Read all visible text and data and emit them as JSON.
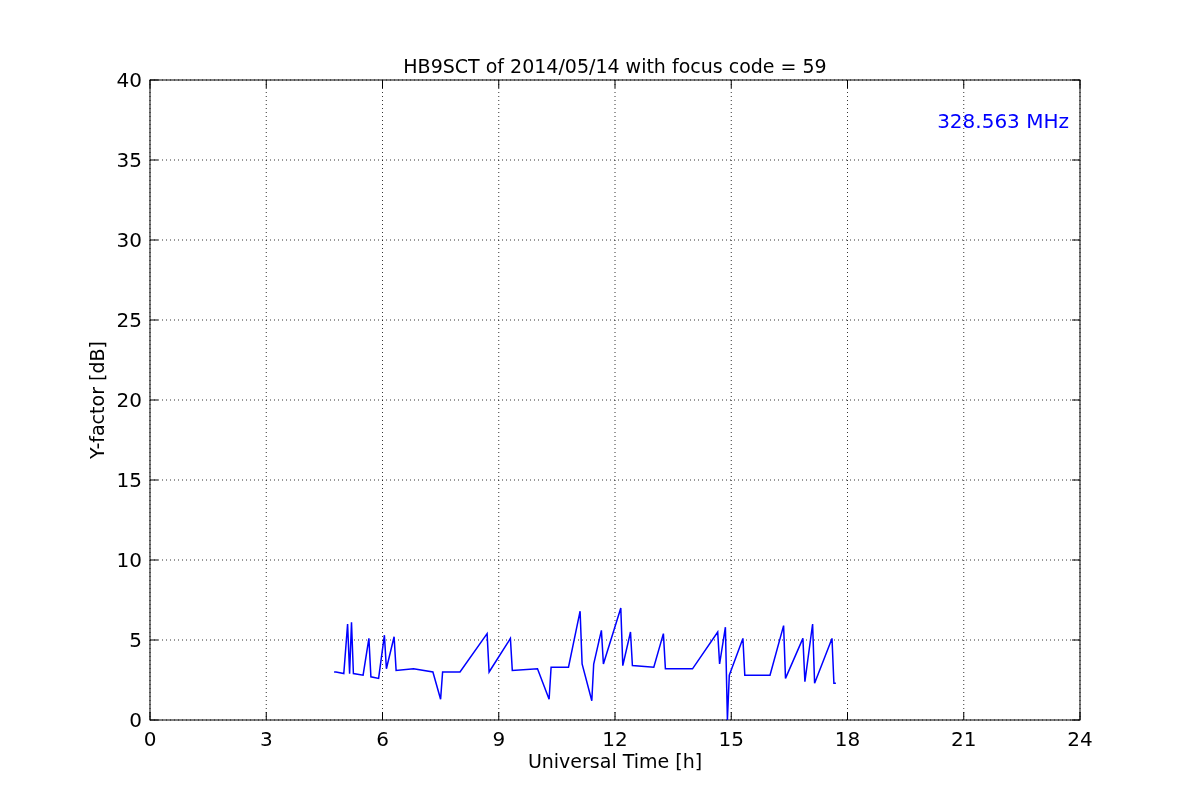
{
  "chart_data": {
    "type": "line",
    "title": "HB9SCT of 2014/05/14 with focus code = 59",
    "xlabel": "Universal Time [h]",
    "ylabel": "Y-factor [dB]",
    "x": [
      4.75,
      4.8,
      5.0,
      5.1,
      5.15,
      5.2,
      5.25,
      5.5,
      5.65,
      5.7,
      5.9,
      6.05,
      6.1,
      6.3,
      6.35,
      6.8,
      7.3,
      7.5,
      7.55,
      8.0,
      8.7,
      8.75,
      9.3,
      9.35,
      10.0,
      10.3,
      10.35,
      10.8,
      11.1,
      11.15,
      11.4,
      11.45,
      11.65,
      11.7,
      12.15,
      12.2,
      12.4,
      12.45,
      13.0,
      13.25,
      13.3,
      14.0,
      14.65,
      14.7,
      14.85,
      14.9,
      14.95,
      15.3,
      15.35,
      16.0,
      16.35,
      16.4,
      16.85,
      16.9,
      17.1,
      17.15,
      17.6,
      17.65,
      17.7
    ],
    "series": [
      {
        "name": "328.563 MHz",
        "color": "#0000ff",
        "values": [
          3.0,
          3.0,
          2.9,
          6.0,
          2.9,
          6.1,
          2.9,
          2.8,
          5.1,
          2.7,
          2.6,
          5.3,
          3.2,
          5.2,
          3.1,
          3.2,
          3.0,
          1.3,
          3.0,
          3.0,
          5.4,
          3.0,
          5.1,
          3.1,
          3.2,
          1.3,
          3.3,
          3.3,
          6.8,
          3.5,
          1.2,
          3.5,
          5.6,
          3.5,
          7.0,
          3.4,
          5.5,
          3.4,
          3.3,
          5.4,
          3.2,
          3.2,
          5.5,
          3.5,
          5.8,
          0.0,
          2.8,
          5.1,
          2.8,
          2.8,
          5.9,
          2.6,
          5.1,
          2.4,
          6.0,
          2.3,
          5.1,
          2.3,
          2.3
        ]
      }
    ],
    "xlim": [
      0,
      24
    ],
    "ylim": [
      0,
      40
    ],
    "xticks": [
      0,
      3,
      6,
      9,
      12,
      15,
      18,
      21,
      24
    ],
    "yticks": [
      0,
      5,
      10,
      15,
      20,
      25,
      30,
      35,
      40
    ],
    "grid": true
  }
}
